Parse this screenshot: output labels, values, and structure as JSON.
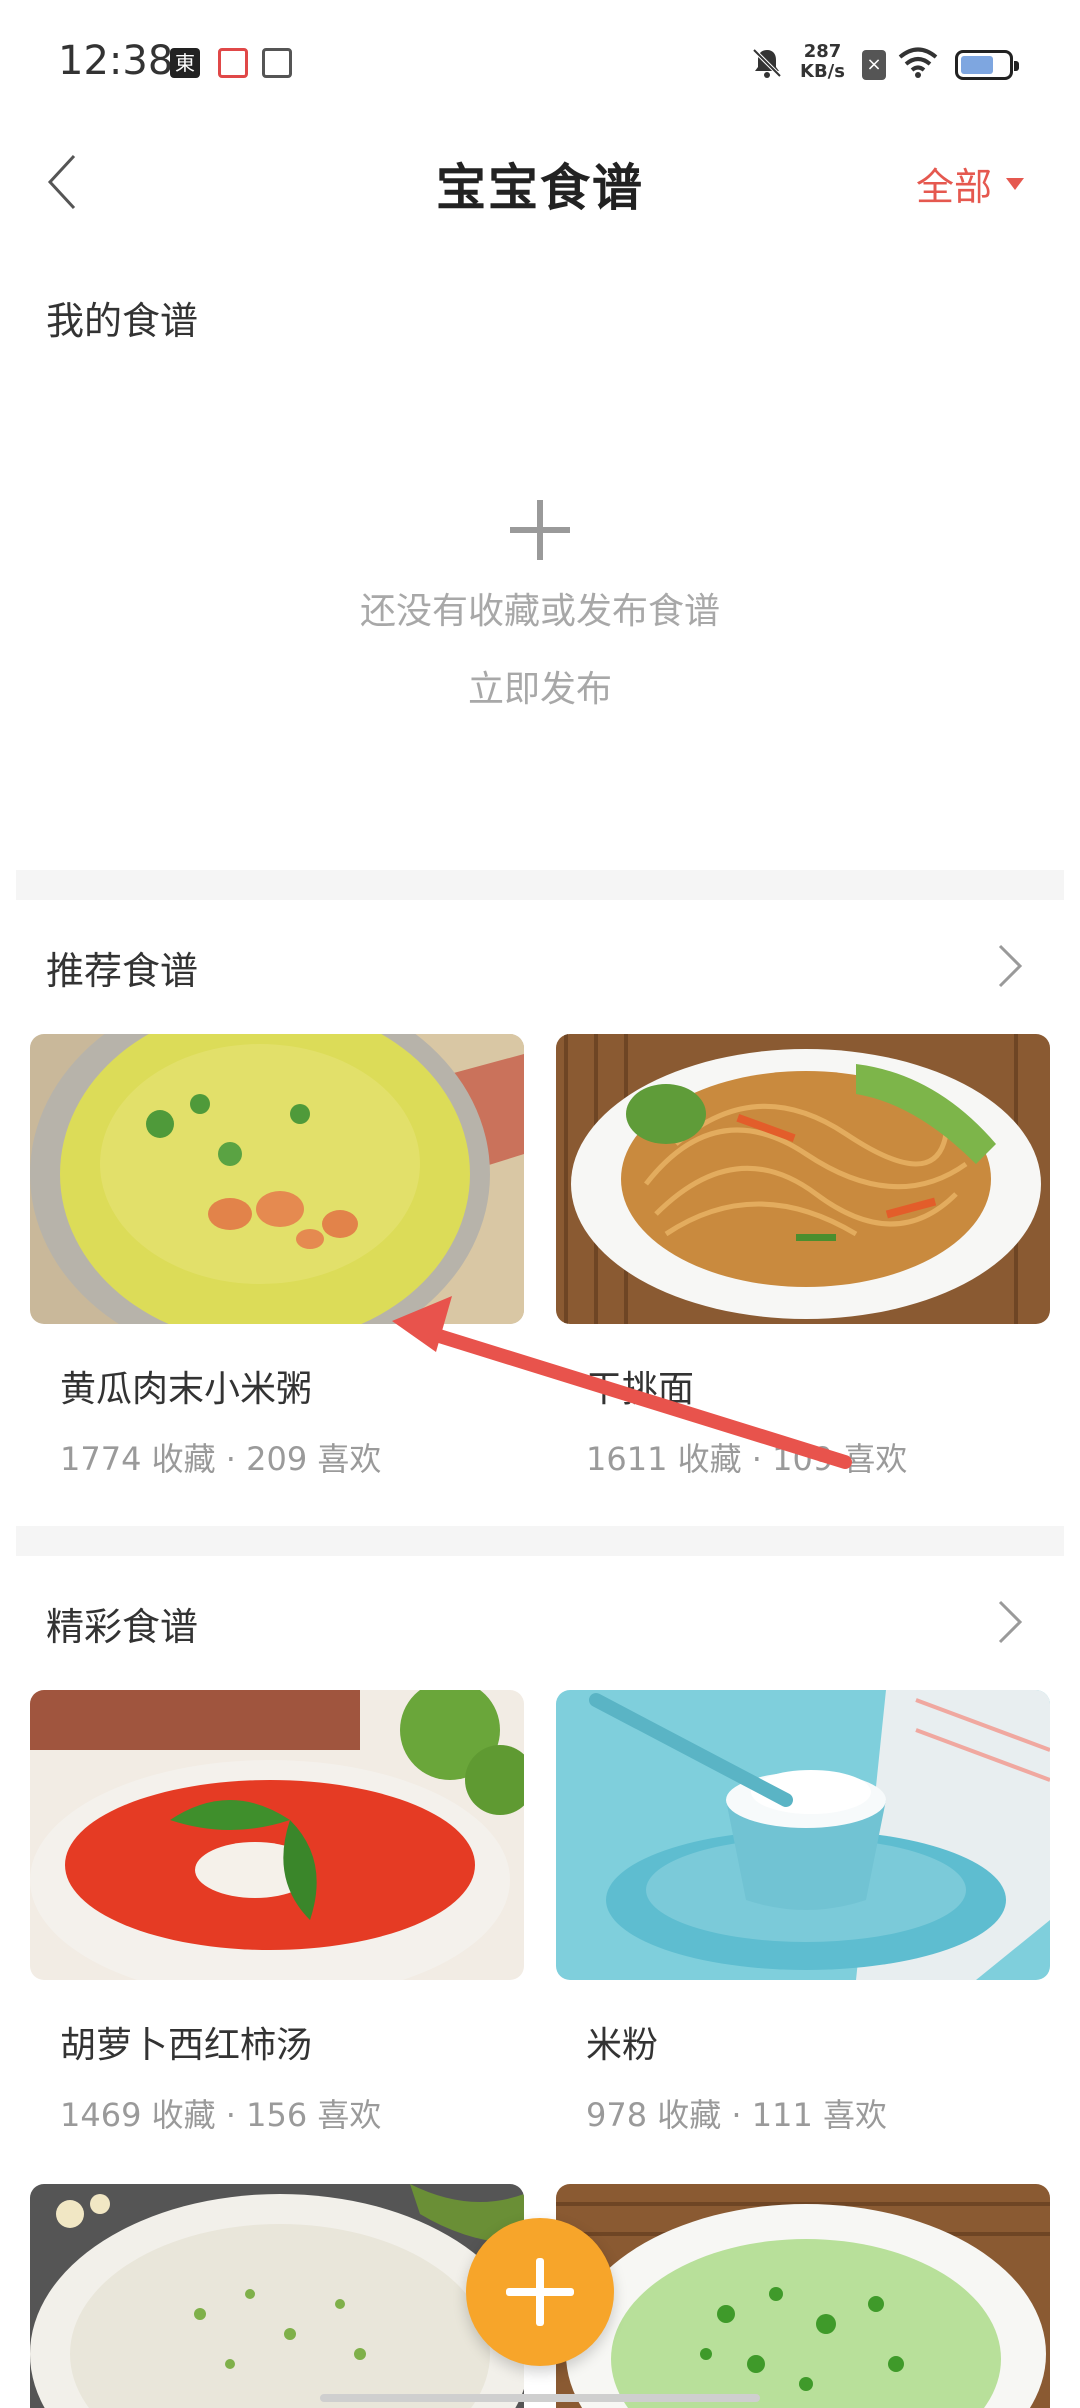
{
  "status_bar": {
    "time": "12:38",
    "app_icon_jd": "東",
    "net_speed_value": "287",
    "net_speed_unit": "KB/s",
    "battery_level": 0.7
  },
  "header": {
    "back_icon": "chevron-left-icon",
    "title": "宝宝食谱",
    "filter_label": "全部"
  },
  "my_recipes": {
    "title": "我的食谱",
    "empty_text": "还没有收藏或发布食谱",
    "publish_label": "立即发布"
  },
  "recommended": {
    "title": "推荐食谱",
    "items": [
      {
        "name": "黄瓜肉末小米粥",
        "stats": "1774 收藏 · 209 喜欢"
      },
      {
        "name": "干挑面",
        "stats": "1611 收藏 · 109 喜欢"
      }
    ]
  },
  "featured": {
    "title": "精彩食谱",
    "items": [
      {
        "name": "胡萝卜西红柿汤",
        "stats": "1469 收藏 · 156 喜欢"
      },
      {
        "name": "米粉",
        "stats": "978 收藏 · 111 喜欢"
      }
    ]
  },
  "colors": {
    "accent": "#e5584f",
    "fab": "#f7a52a",
    "annotation_arrow": "#e8534c"
  }
}
